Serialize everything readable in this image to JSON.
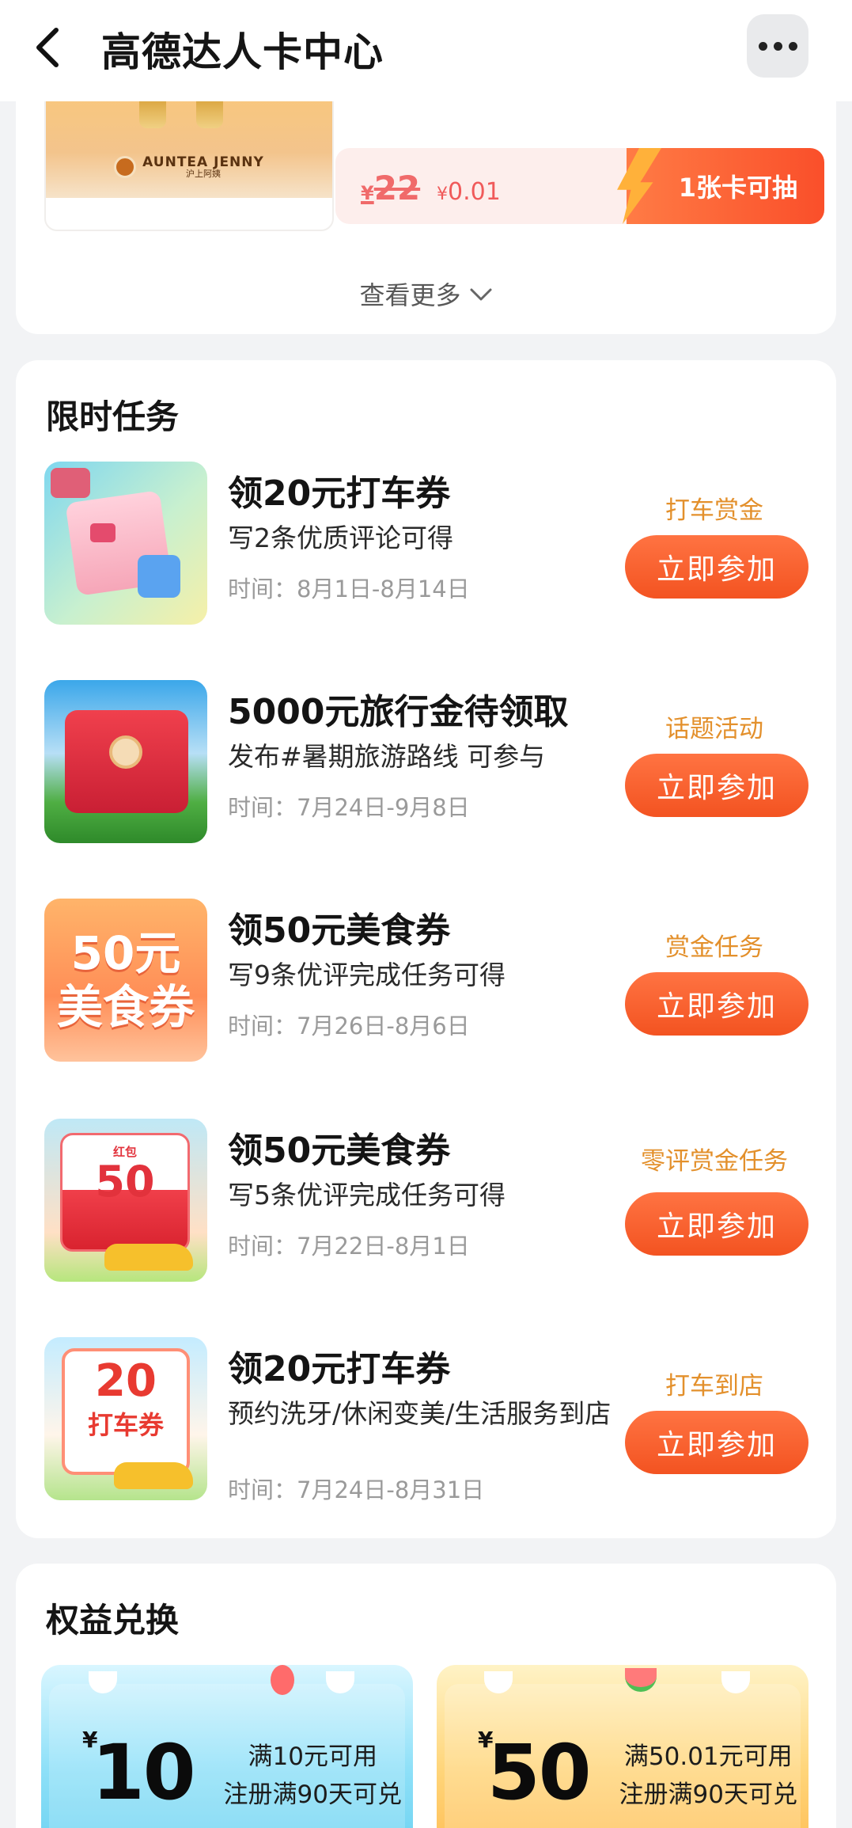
{
  "header": {
    "title": "高德达人卡中心",
    "back_icon": "chevron-left-icon",
    "more_icon": "more-dots-icon"
  },
  "top_card": {
    "brand_name": "AUNTEA JENNY",
    "brand_sub": "沪上阿姨",
    "old_price_symbol": "¥",
    "old_price": "22",
    "new_price_symbol": "¥",
    "new_price": "0.01",
    "draw_label": "1张卡可抽",
    "see_more": "查看更多"
  },
  "tasks": {
    "title": "限时任务",
    "join_label": "立即参加",
    "items": [
      {
        "name": "领20元打车券",
        "desc": "写2条优质评论可得",
        "time": "时间：8月1日-8月14日",
        "tag": "打车赏金"
      },
      {
        "name": "5000元旅行金待领取",
        "desc": "发布#暑期旅游路线 可参与",
        "time": "时间：7月24日-9月8日",
        "tag": "话题活动"
      },
      {
        "name": "领50元美食券",
        "desc": "写9条优评完成任务可得",
        "time": "时间：7月26日-8月6日",
        "tag": "赏金任务",
        "thumb_line1": "50元",
        "thumb_line2": "美食券"
      },
      {
        "name": "领50元美食券",
        "desc": "写5条优评完成任务可得",
        "time": "时间：7月22日-8月1日",
        "tag": "零评赏金任务",
        "thumb_small": "红包",
        "thumb_num": "50"
      },
      {
        "name": "领20元打车券",
        "desc": "预约洗牙/休闲变美/生活服务到店",
        "time": "时间：7月24日-8月31日",
        "tag": "打车到店",
        "thumb_num": "20",
        "thumb_label": "打车券"
      }
    ]
  },
  "exchange": {
    "title": "权益兑换",
    "coupons": [
      {
        "symbol": "¥",
        "amount": "10",
        "line1": "满10元可用",
        "line2": "注册满90天可兑"
      },
      {
        "symbol": "¥",
        "amount": "50",
        "line1": "满50.01元可用",
        "line2": "注册满90天可兑"
      }
    ]
  },
  "colors": {
    "accent": "#f35321",
    "tag": "#e3902c",
    "bg": "#f2f3f5"
  }
}
